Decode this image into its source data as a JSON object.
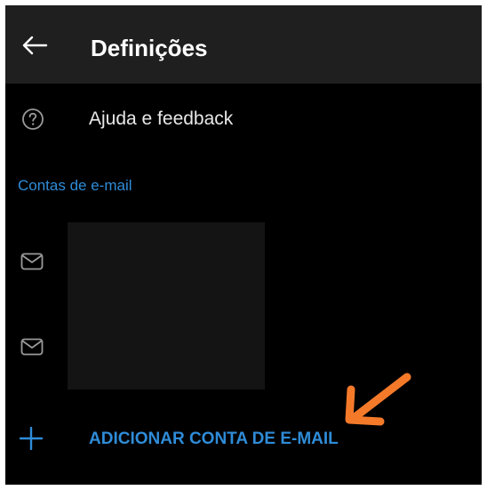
{
  "header": {
    "title": "Definições",
    "back_icon": "arrow-left-icon"
  },
  "menu": {
    "help_label": "Ajuda e feedback",
    "help_icon": "help-circle-icon"
  },
  "accounts_section": {
    "header": "Contas de e-mail",
    "accounts": [
      {
        "icon": "mail-icon"
      },
      {
        "icon": "mail-icon"
      }
    ]
  },
  "add_account": {
    "label": "ADICIONAR CONTA DE E-MAIL",
    "icon": "plus-icon"
  },
  "colors": {
    "app_bar": "#1f1f1f",
    "background": "#000000",
    "accent": "#2f8cd8",
    "annotation_arrow": "#f47a2a"
  }
}
